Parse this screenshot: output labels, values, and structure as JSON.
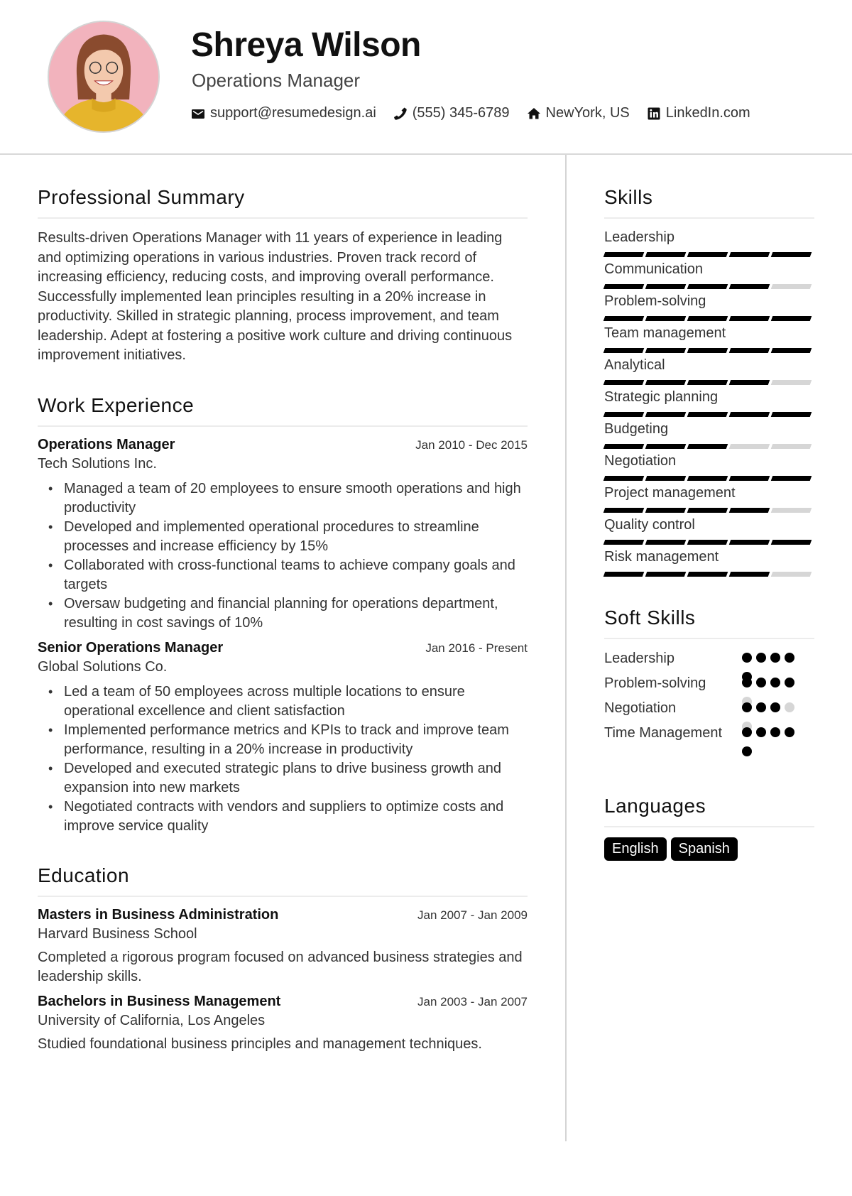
{
  "header": {
    "name": "Shreya Wilson",
    "title": "Operations Manager",
    "contacts": [
      {
        "icon": "envelope-icon",
        "text": "support@resumedesign.ai"
      },
      {
        "icon": "phone-icon",
        "text": "(555) 345-6789"
      },
      {
        "icon": "home-icon",
        "text": "NewYork, US"
      },
      {
        "icon": "linkedin-icon",
        "text": "LinkedIn.com"
      }
    ]
  },
  "summary": {
    "heading": "Professional Summary",
    "text": "Results-driven Operations Manager with 11 years of experience in leading and optimizing operations in various industries. Proven track record of increasing efficiency, reducing costs, and improving overall performance. Successfully implemented lean principles resulting in a 20% increase in productivity. Skilled in strategic planning, process improvement, and team leadership. Adept at fostering a positive work culture and driving continuous improvement initiatives."
  },
  "experience": {
    "heading": "Work Experience",
    "jobs": [
      {
        "title": "Operations Manager",
        "dates": "Jan 2010 - Dec 2015",
        "company": "Tech Solutions Inc.",
        "bullets": [
          "Managed a team of 20 employees to ensure smooth operations and high productivity",
          "Developed and implemented operational procedures to streamline processes and increase efficiency by 15%",
          "Collaborated with cross-functional teams to achieve company goals and targets",
          "Oversaw budgeting and financial planning for operations department, resulting in cost savings of 10%"
        ]
      },
      {
        "title": "Senior Operations Manager",
        "dates": "Jan 2016 - Present",
        "company": "Global Solutions Co.",
        "bullets": [
          "Led a team of 50 employees across multiple locations to ensure operational excellence and client satisfaction",
          "Implemented performance metrics and KPIs to track and improve team performance, resulting in a 20% increase in productivity",
          "Developed and executed strategic plans to drive business growth and expansion into new markets",
          "Negotiated contracts with vendors and suppliers to optimize costs and improve service quality"
        ]
      }
    ]
  },
  "education": {
    "heading": "Education",
    "items": [
      {
        "degree": "Masters in Business Administration",
        "dates": "Jan 2007 - Jan 2009",
        "school": "Harvard Business School",
        "description": "Completed a rigorous program focused on advanced business strategies and leadership skills."
      },
      {
        "degree": "Bachelors in Business Management",
        "dates": "Jan 2003 - Jan 2007",
        "school": "University of California, Los Angeles",
        "description": "Studied foundational business principles and management techniques."
      }
    ]
  },
  "skills": {
    "heading": "Skills",
    "max": 5,
    "items": [
      {
        "name": "Leadership",
        "level": 5
      },
      {
        "name": "Communication",
        "level": 4
      },
      {
        "name": "Problem-solving",
        "level": 5
      },
      {
        "name": "Team management",
        "level": 5
      },
      {
        "name": "Analytical",
        "level": 4
      },
      {
        "name": "Strategic planning",
        "level": 5
      },
      {
        "name": "Budgeting",
        "level": 3
      },
      {
        "name": "Negotiation",
        "level": 5
      },
      {
        "name": "Project management",
        "level": 4
      },
      {
        "name": "Quality control",
        "level": 5
      },
      {
        "name": "Risk management",
        "level": 4
      }
    ]
  },
  "soft_skills": {
    "heading": "Soft Skills",
    "max": 5,
    "items": [
      {
        "name": "Leadership",
        "level": 5
      },
      {
        "name": "Problem-solving",
        "level": 4
      },
      {
        "name": "Negotiation",
        "level": 3
      },
      {
        "name": "Time Management",
        "level": 5
      }
    ]
  },
  "languages": {
    "heading": "Languages",
    "items": [
      "English",
      "Spanish"
    ]
  },
  "colors": {
    "accent": "#000000",
    "inactive": "#d6d6d6",
    "avatar_bg": "#f2b3bd"
  }
}
